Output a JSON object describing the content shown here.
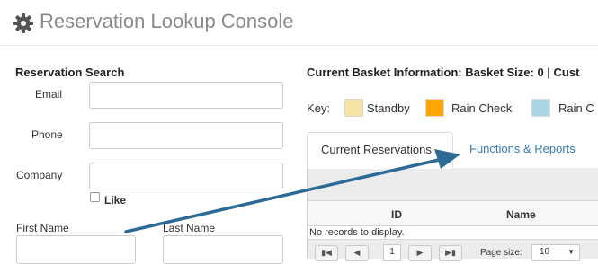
{
  "header": {
    "title": "Reservation Lookup Console",
    "icon": "gear-icon"
  },
  "search": {
    "title": "Reservation Search",
    "email_label": "Email",
    "email_value": "",
    "phone_label": "Phone",
    "phone_value": "",
    "company_label": "Company",
    "company_value": "",
    "like_label": "Like",
    "like_checked": false,
    "first_name_label": "First Name",
    "first_name_value": "",
    "last_name_label": "Last Name",
    "last_name_value": ""
  },
  "basket": {
    "text": "Current Basket Information: Basket Size: 0 | Cust"
  },
  "key": {
    "label": "Key:",
    "items": [
      {
        "label": "Standby",
        "color": "#f6e3a3"
      },
      {
        "label": "Rain Check",
        "color": "#ffa500"
      },
      {
        "label": "Rain C",
        "color": "#a9d6e5"
      }
    ]
  },
  "tabs": [
    {
      "label": "Current Reservations",
      "active": true
    },
    {
      "label": "Functions & Reports",
      "active": false
    }
  ],
  "grid": {
    "columns": [
      "ID",
      "Name"
    ],
    "empty_text": "No records to display.",
    "pager": {
      "current_page": "1",
      "page_size_label": "Page size:",
      "page_size": "10"
    }
  },
  "annotation": {
    "color": "#2e6a96"
  }
}
